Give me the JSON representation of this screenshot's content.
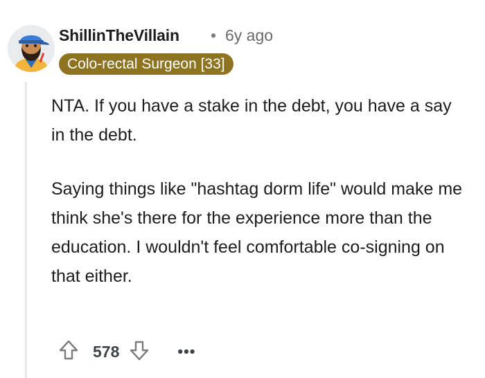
{
  "comment": {
    "username": "ShillinTheVillain",
    "separator": "•",
    "timestamp": "6y ago",
    "flair": "Colo-rectal Surgeon [33]",
    "paragraphs": [
      "NTA. If you have a stake in the debt, you have a say in the debt.",
      "Saying things like \"hashtag dorm life\" would make me think she's there for the experience more than the education. I wouldn't feel comfortable co-signing on that either."
    ],
    "score": "578",
    "more_label": "•••"
  },
  "icons": {
    "avatar": "avatar-bearded-cap",
    "upvote": "arrow-up-icon",
    "downvote": "arrow-down-icon",
    "more": "ellipsis-icon"
  },
  "colors": {
    "flair_bg": "#8e7420",
    "text": "#1c1c1c",
    "meta": "#6a6a6a",
    "thread_line": "#e8e8e8"
  }
}
